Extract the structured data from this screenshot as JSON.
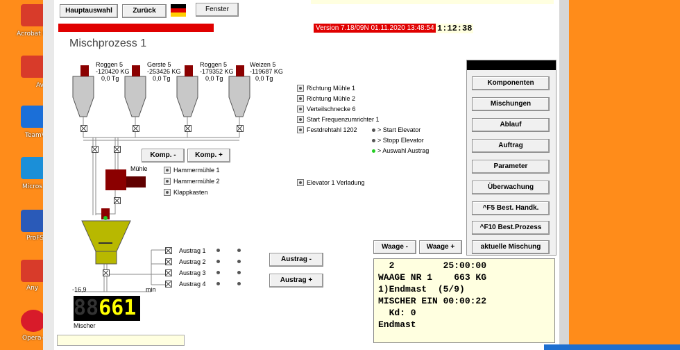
{
  "desktop": {
    "icons": [
      {
        "label": "Acrobat R",
        "color": "#d83b2a"
      },
      {
        "label": "Av",
        "color": "#d83b2a"
      },
      {
        "label": "TeamV",
        "color": "#1b6fd8"
      },
      {
        "label": "Micros",
        "color": "#1b8fd8"
      },
      {
        "label": "ProFS",
        "color": "#2a5ab8"
      },
      {
        "label": "Any",
        "color": "#d83b2a"
      },
      {
        "label": "Opera-I",
        "color": "#d81b2a"
      }
    ]
  },
  "toolbar": {
    "hauptauswahl": "Hauptauswahl",
    "zurueck": "Zurück",
    "fenster": "Fenster"
  },
  "status": {
    "version": "Version 7.18/09N   01.11.2020  13:48:54",
    "clock": "1:12:38"
  },
  "page_title": "Mischprozess 1",
  "silos": [
    {
      "name": "Roggen 5",
      "weight": "-120420 KG",
      "tg": "0,0 Tg"
    },
    {
      "name": "Gerste 5",
      "weight": "-253426 KG",
      "tg": "0,0 Tg"
    },
    {
      "name": "Roggen 5",
      "weight": "-179352 KG",
      "tg": "0,0 Tg"
    },
    {
      "name": "Weizen 5",
      "weight": "-119687 KG",
      "tg": "0,0 Tg"
    }
  ],
  "signals": [
    "Richtung Mühle 1",
    "Richtung Mühle 2",
    "Verteilschnecke 6",
    "Start Frequenzumrichter 1",
    "Festdrehtahl 1202"
  ],
  "elevator_signals": [
    "> Start Elevator",
    "> Stopp Elevator",
    "> Auswahl Austrag"
  ],
  "komp_buttons": {
    "minus": "Komp. -",
    "plus": "Komp. +"
  },
  "muehle": {
    "label": "Mühle",
    "items": [
      "Hammermühle 1",
      "Hammermühle 2",
      "Klappkasten"
    ]
  },
  "elevator_verladung": "Elevator 1 Verladung",
  "austrag": [
    "Austrag  1",
    "Austrag  2",
    "Austrag  3",
    "Austrag  4"
  ],
  "austrag_buttons": {
    "minus": "Austrag -",
    "plus": "Austrag +"
  },
  "waage_buttons": {
    "minus": "Waage -",
    "plus": "Waage +"
  },
  "side_menu": [
    "Komponenten",
    "Mischungen",
    "Ablauf",
    "Auftrag",
    "Parameter",
    "Überwachung",
    "^F5 Best. Handk.",
    "^F10 Best.Prozess",
    "aktuelle Mischung"
  ],
  "mixer": {
    "temp": "-16,9",
    "min_label": "min",
    "display_dim": "88",
    "display_value": "661",
    "label": "Mischer"
  },
  "info_lines": [
    "  2         25:00:00",
    "WAAGE NR 1    663 KG",
    "1)Endmast  (5/9)",
    "MISCHER EIN 00:00:22",
    "  Kd: 0",
    "Endmast"
  ],
  "colors": {
    "accent": "#ff8c1a",
    "alarm": "#e00000",
    "motor": "#8b0000",
    "mixer": "#b8b800",
    "display": "#ffff00"
  }
}
